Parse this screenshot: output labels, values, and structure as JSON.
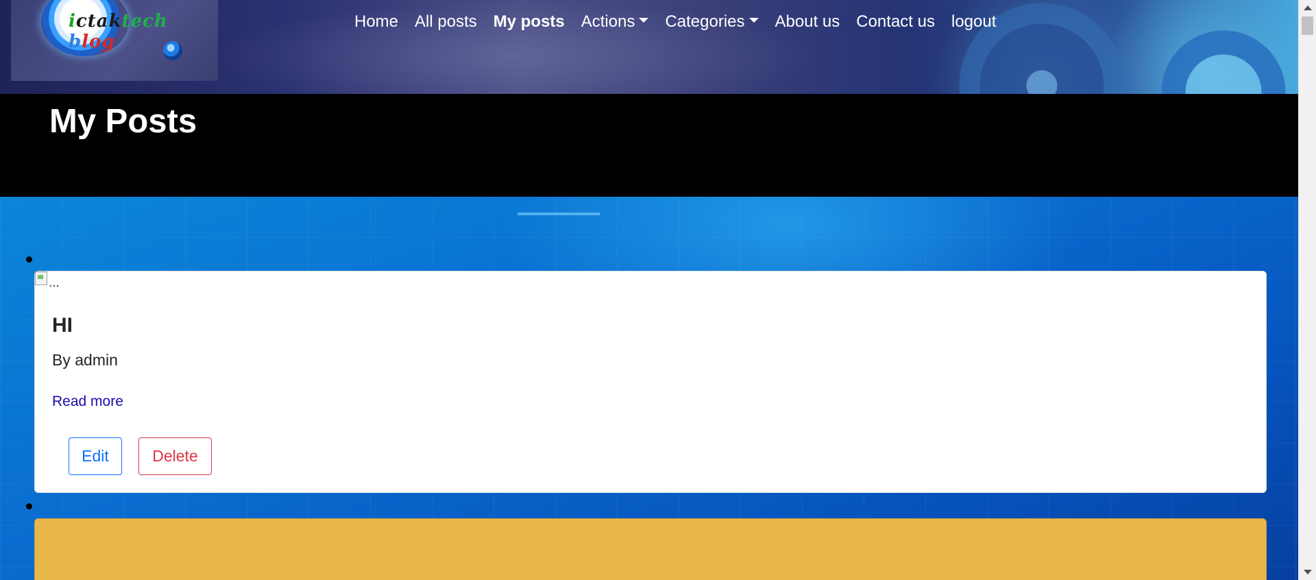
{
  "brand": {
    "logo_text_parts": [
      "i",
      "ctak",
      "tech",
      " b",
      "log"
    ]
  },
  "nav": {
    "items": [
      {
        "label": "Home"
      },
      {
        "label": "All posts"
      },
      {
        "label": "My posts",
        "active": true
      },
      {
        "label": "Actions",
        "dropdown": true
      },
      {
        "label": "Categories",
        "dropdown": true
      },
      {
        "label": "About us"
      },
      {
        "label": "Contact us"
      },
      {
        "label": "logout"
      }
    ]
  },
  "page": {
    "title": "My Posts"
  },
  "posts": [
    {
      "image_alt": "...",
      "title": "HI",
      "author": "By admin",
      "read_more": "Read more",
      "edit_label": "Edit",
      "delete_label": "Delete"
    }
  ],
  "colors": {
    "card_secondary_bg": "#e9b64a",
    "edit_button": "#0d6efd",
    "delete_button": "#dc3545",
    "link": "#1a0dab",
    "title_band": "#000000"
  },
  "icons": {
    "broken_image": "broken-image-icon",
    "dropdown": "caret-down-icon"
  }
}
